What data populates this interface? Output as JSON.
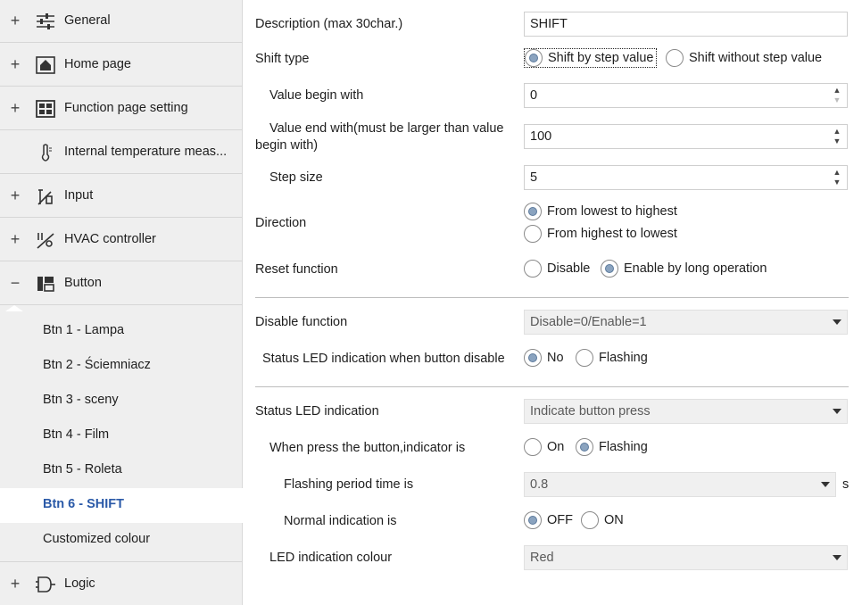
{
  "sidebar": {
    "items": [
      {
        "expander": "+",
        "icon": "sliders-icon",
        "label": "General"
      },
      {
        "expander": "+",
        "icon": "home-icon",
        "label": "Home page"
      },
      {
        "expander": "+",
        "icon": "grid-icon",
        "label": "Function page setting"
      },
      {
        "expander": "",
        "icon": "thermometer-icon",
        "label": "Internal temperature meas..."
      },
      {
        "expander": "+",
        "icon": "input-icon",
        "label": "Input"
      },
      {
        "expander": "+",
        "icon": "hvac-icon",
        "label": "HVAC controller"
      },
      {
        "expander": "−",
        "icon": "button-layout-icon",
        "label": "Button"
      },
      {
        "expander": "+",
        "icon": "logic-icon",
        "label": "Logic"
      }
    ],
    "subitems": [
      {
        "label": "Btn 1 - Lampa"
      },
      {
        "label": "Btn 2 - Ściemniacz"
      },
      {
        "label": "Btn 3 - sceny"
      },
      {
        "label": "Btn 4 - Film"
      },
      {
        "label": "Btn 5 - Roleta"
      },
      {
        "label": "Btn 6 - SHIFT"
      },
      {
        "label": "Customized colour"
      }
    ],
    "active_subitem": "Btn 6 - SHIFT"
  },
  "form": {
    "description": {
      "label": "Description (max 30char.)",
      "value": "SHIFT"
    },
    "shift_type": {
      "label": "Shift type",
      "options": [
        "Shift by step value",
        "Shift without step value"
      ],
      "selected": "Shift by step value"
    },
    "value_begin": {
      "label": "Value begin with",
      "value": "0"
    },
    "value_end": {
      "label_line1": "Value end with(must be larger than value",
      "label_line2": "begin with)",
      "value": "100"
    },
    "step_size": {
      "label": "Step  size",
      "value": "5"
    },
    "direction": {
      "label": "Direction",
      "options": [
        "From lowest to highest",
        "From highest to lowest"
      ],
      "selected": "From lowest to highest"
    },
    "reset_function": {
      "label": "Reset function",
      "options": [
        "Disable",
        "Enable by long operation"
      ],
      "selected": "Enable by long operation"
    },
    "disable_function": {
      "label": "Disable function",
      "value": "Disable=0/Enable=1"
    },
    "status_led_disable": {
      "label": "Status LED indication when button disable",
      "options": [
        "No",
        "Flashing"
      ],
      "selected": "No"
    },
    "status_led": {
      "label": "Status LED indication",
      "value": "Indicate button press"
    },
    "when_press": {
      "label": "When press the button,indicator is",
      "options": [
        "On",
        "Flashing"
      ],
      "selected": "Flashing"
    },
    "flashing_period": {
      "label": "Flashing period time is",
      "value": "0.8",
      "unit": "s"
    },
    "normal_indication": {
      "label": "Normal indication is",
      "options": [
        "OFF",
        "ON"
      ],
      "selected": "OFF"
    },
    "led_colour": {
      "label": "LED indication colour",
      "value": "Red"
    }
  },
  "colors": {
    "accent": "#2b5aa8",
    "sidebar_bg": "#efefef",
    "radio_fill": "#8aa3bf"
  }
}
